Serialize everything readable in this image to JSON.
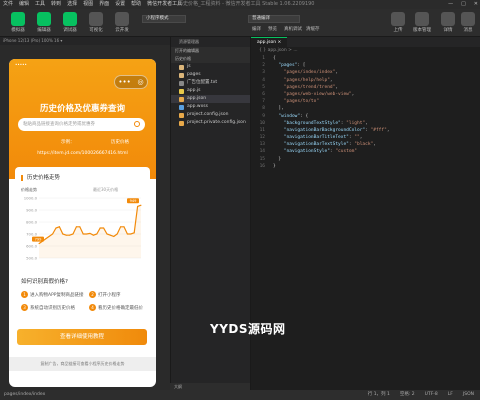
{
  "menubar": {
    "items": [
      "文件",
      "编辑",
      "工具",
      "转到",
      "选择",
      "视图",
      "界面",
      "设置",
      "帮助",
      "微信开发者工具"
    ],
    "title": "历史价格_工程资料 - 微信开发者工具 Stable 1.06.2209190",
    "window_controls": [
      "—",
      "□",
      "✕"
    ]
  },
  "toolbar": {
    "buttons_left": [
      "模拟器",
      "编辑器",
      "调试器",
      "可视化",
      "云开发"
    ],
    "mode_select": "小程序模式",
    "compile_select": "普通编译",
    "compile_buttons": [
      "编译",
      "预览",
      "真机调试",
      "清缓存"
    ],
    "buttons_right": [
      "上传",
      "版本管理",
      "详情",
      "消息"
    ]
  },
  "simulator": {
    "device_bar": "iPhone 12/13 (Pro) 100% 16 ▾",
    "status_time": "•••••",
    "capsule_more": "•••",
    "capsule_close": "◎",
    "hero_title": "历史价格及优惠券查询",
    "search_placeholder": "粘贴商品链接查询价格走势或优惠券",
    "hero_left": "示例：",
    "hero_right": "历史价格",
    "hero_url": "https://item.jd.com/100026667416.html",
    "section_trend": "历史价格走势",
    "chart_label": "价格走势",
    "chart_range": "最近30天价格",
    "how_title": "如何识别真假价格?",
    "steps": [
      {
        "num": "1",
        "text": "进入购物APP复制商品链接"
      },
      {
        "num": "2",
        "text": "打开小程序"
      },
      {
        "num": "3",
        "text": "系统自动识别历史价格"
      },
      {
        "num": "4",
        "text": "看历史价格确定最低价"
      }
    ],
    "cta": "查看详细使用教程",
    "footnote": "复制广告，商品链接可查看小程序历史价格走势"
  },
  "chart_data": {
    "type": "line",
    "title": "价格走势",
    "y_ticks": [
      "1000.0",
      "900.0",
      "800.0",
      "700.0",
      "600.0",
      "500.0"
    ],
    "ylim": [
      500,
      1000
    ],
    "values": [
      620,
      640,
      660,
      680,
      700,
      750,
      760,
      700,
      690,
      690,
      700,
      760,
      760,
      700,
      700,
      705,
      690,
      700,
      750,
      750,
      700,
      690,
      680,
      700,
      760,
      760,
      700,
      700,
      710,
      930,
      940
    ],
    "tags": [
      "949",
      "799"
    ],
    "color": "#f28a0a"
  },
  "explorer": {
    "header": "资源管理器",
    "open_editors": "打开的编辑器",
    "project": "历史价格",
    "items": [
      {
        "name": "js",
        "type": "folder"
      },
      {
        "name": "pages",
        "type": "folder"
      },
      {
        "name": "广告位配置.txt",
        "type": "file"
      },
      {
        "name": "app.js",
        "type": "file"
      },
      {
        "name": "app.json",
        "type": "file",
        "selected": true
      },
      {
        "name": "app.wxss",
        "type": "file"
      },
      {
        "name": "project.config.json",
        "type": "file"
      },
      {
        "name": "project.private.config.json",
        "type": "file"
      }
    ],
    "outline": "大纲"
  },
  "editor": {
    "tab": "app.json ×",
    "breadcrumb": "{ } app.json > ...",
    "lines": [
      {
        "n": "1",
        "t": "{"
      },
      {
        "n": "2",
        "t": "  \"pages\": ["
      },
      {
        "n": "3",
        "t": "    \"pages/index/index\","
      },
      {
        "n": "4",
        "t": "    \"pages/help/help\","
      },
      {
        "n": "5",
        "t": "    \"pages/trend/trend\","
      },
      {
        "n": "6",
        "t": "    \"pages/web-view/web-view\","
      },
      {
        "n": "7",
        "t": "    \"pages/to/to\""
      },
      {
        "n": "8",
        "t": "  ],"
      },
      {
        "n": "9",
        "t": "  \"window\": {"
      },
      {
        "n": "10",
        "t": "    \"backgroundTextStyle\": \"light\","
      },
      {
        "n": "11",
        "t": "    \"navigationBarBackgroundColor\": \"#fff\","
      },
      {
        "n": "12",
        "t": "    \"navigationBarTitleText\": \"\","
      },
      {
        "n": "13",
        "t": "    \"navigationBarTextStyle\": \"black\","
      },
      {
        "n": "14",
        "t": "    \"navigationStyle\": \"custom\""
      },
      {
        "n": "15",
        "t": "  }"
      },
      {
        "n": "16",
        "t": "}"
      }
    ]
  },
  "watermark": "YYDS源码网",
  "statusbar": {
    "left": "pages/index/index",
    "right": [
      "行 1，列 1",
      "空格: 2",
      "UTF-8",
      "LF",
      "JSON"
    ]
  }
}
